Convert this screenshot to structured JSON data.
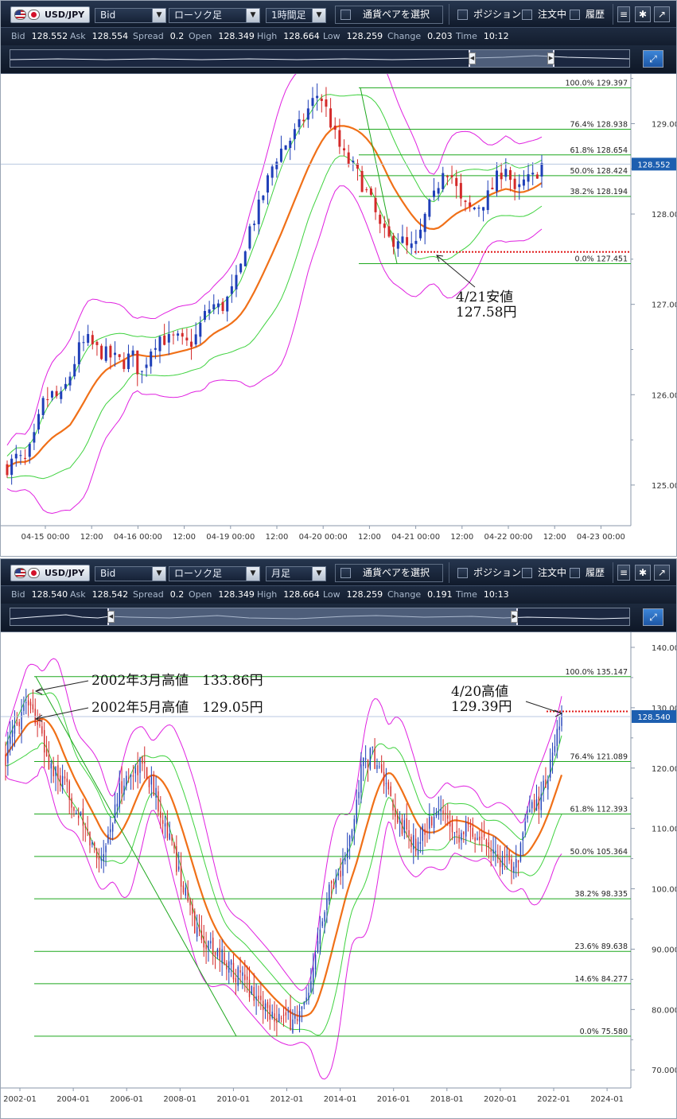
{
  "top": {
    "toolbar": {
      "pair": "USD/JPY",
      "price_type": "Bid",
      "chart_type": "ローソク足",
      "timeframe": "1時間足",
      "pair_select": "通貨ペアを選択",
      "position": "ポジション",
      "orders": "注文中",
      "history": "履歴"
    },
    "info": {
      "bid_k": "Bid",
      "bid": "128.552",
      "ask_k": "Ask",
      "ask": "128.554",
      "spread_k": "Spread",
      "spread": "0.2",
      "open_k": "Open",
      "open": "128.349",
      "high_k": "High",
      "high": "128.664",
      "low_k": "Low",
      "low": "128.259",
      "change_k": "Change",
      "change": "0.203",
      "time_k": "Time",
      "time": "10:12"
    },
    "annotation": {
      "line1": "4/21安値",
      "line2": "127.58円"
    }
  },
  "bottom": {
    "toolbar": {
      "pair": "USD/JPY",
      "price_type": "Bid",
      "chart_type": "ローソク足",
      "timeframe": "月足",
      "pair_select": "通貨ペアを選択",
      "position": "ポジション",
      "orders": "注文中",
      "history": "履歴"
    },
    "info": {
      "bid_k": "Bid",
      "bid": "128.540",
      "ask_k": "Ask",
      "ask": "128.542",
      "spread_k": "Spread",
      "spread": "0.2",
      "open_k": "Open",
      "open": "128.349",
      "high_k": "High",
      "high": "128.664",
      "low_k": "Low",
      "low": "128.259",
      "change_k": "Change",
      "change": "0.191",
      "time_k": "Time",
      "time": "10:13"
    },
    "annotations": {
      "a1": "2002年3月高値　133.86円",
      "a2": "2002年5月高値　129.05円",
      "a3_line1": "4/20高値",
      "a3_line2": "129.39円"
    }
  },
  "colors": {
    "up": "#1f3fb8",
    "down": "#d42a2a",
    "ma": "#f07018",
    "band1": "#3fd23f",
    "band2": "#e020e0",
    "fib": "#1ea81e",
    "dotted": "#e01818",
    "current": "#b8c8e0"
  },
  "chart_data": [
    {
      "type": "candlestick",
      "title": "",
      "ylim": [
        124.55,
        129.55
      ],
      "y_ticks": [
        125.0,
        126.0,
        127.0,
        128.0,
        129.0
      ],
      "y_tick_labels": [
        "125.000",
        "126.000",
        "127.000",
        "128.000",
        "129.000"
      ],
      "x_tick_labels": [
        "04-15 00:00",
        "12:00",
        "04-16 00:00",
        "12:00",
        "04-19 00:00",
        "12:00",
        "04-20 00:00",
        "12:00",
        "04-21 00:00",
        "12:00",
        "04-22 00:00",
        "12:00",
        "04-23 00:00"
      ],
      "current_price": "128.552",
      "fib_levels": [
        {
          "pct": "100.0%",
          "price": "129.397",
          "value": 129.397
        },
        {
          "pct": "76.4%",
          "price": "128.938",
          "value": 128.938
        },
        {
          "pct": "61.8%",
          "price": "128.654",
          "value": 128.654
        },
        {
          "pct": "50.0%",
          "price": "128.424",
          "value": 128.424
        },
        {
          "pct": "38.2%",
          "price": "128.194",
          "value": 128.194
        },
        {
          "pct": "0.0%",
          "price": "127.451",
          "value": 127.451
        }
      ],
      "support_line": 127.58,
      "close_path": [
        125.2,
        125.3,
        125.25,
        125.5,
        125.9,
        126.0,
        125.95,
        126.2,
        126.5,
        126.6,
        126.5,
        126.45,
        126.4,
        126.35,
        126.45,
        126.2,
        126.5,
        126.65,
        126.6,
        126.62,
        126.55,
        126.6,
        126.85,
        127.0,
        126.95,
        127.1,
        127.3,
        127.8,
        128.0,
        128.3,
        128.6,
        128.75,
        128.85,
        129.0,
        129.2,
        129.35,
        129.1,
        128.8,
        128.6,
        128.5,
        128.3,
        128.1,
        127.8,
        127.7,
        127.75,
        127.6,
        127.65,
        128.0,
        128.2,
        128.55,
        128.4,
        128.1,
        128.05,
        128.1,
        128.2,
        128.4,
        128.55,
        128.2,
        128.35,
        128.4,
        128.55
      ],
      "series": [
        {
          "name": "",
          "values": []
        }
      ]
    },
    {
      "type": "candlestick",
      "title": "",
      "ylim": [
        67.0,
        142.5
      ],
      "y_ticks": [
        70,
        80,
        90,
        100,
        110,
        120,
        130,
        140
      ],
      "y_tick_labels": [
        "70.000",
        "80.000",
        "90.000",
        "100.000",
        "110.000",
        "120.000",
        "130.000",
        "140.000"
      ],
      "x_tick_labels": [
        "2002-01",
        "2004-01",
        "2006-01",
        "2008-01",
        "2010-01",
        "2012-01",
        "2014-01",
        "2016-01",
        "2018-01",
        "2020-01",
        "2022-01",
        "2024-01"
      ],
      "current_price": "128.540",
      "fib_levels": [
        {
          "pct": "100.0%",
          "price": "135.147",
          "value": 135.147
        },
        {
          "pct": "76.4%",
          "price": "121.089",
          "value": 121.089
        },
        {
          "pct": "61.8%",
          "price": "112.393",
          "value": 112.393
        },
        {
          "pct": "50.0%",
          "price": "105.364",
          "value": 105.364
        },
        {
          "pct": "38.2%",
          "price": "98.335",
          "value": 98.335
        },
        {
          "pct": "23.6%",
          "price": "89.638",
          "value": 89.638
        },
        {
          "pct": "14.6%",
          "price": "84.277",
          "value": 84.277
        },
        {
          "pct": "0.0%",
          "price": "75.580",
          "value": 75.58
        }
      ],
      "resistance_line": 129.39,
      "close_path": [
        122,
        127,
        132,
        128,
        121,
        118,
        116,
        112,
        108,
        105,
        110,
        117,
        119,
        121,
        117,
        112,
        106,
        100,
        94,
        91,
        90,
        88,
        86,
        84,
        82,
        80,
        79,
        78,
        79,
        82,
        95,
        101,
        103,
        109,
        121,
        122,
        118,
        112,
        110,
        107,
        110,
        112,
        113,
        109,
        110,
        109,
        108,
        105,
        104,
        106,
        113,
        115,
        121,
        128
      ],
      "series": [
        {
          "name": "",
          "values": []
        }
      ]
    }
  ]
}
